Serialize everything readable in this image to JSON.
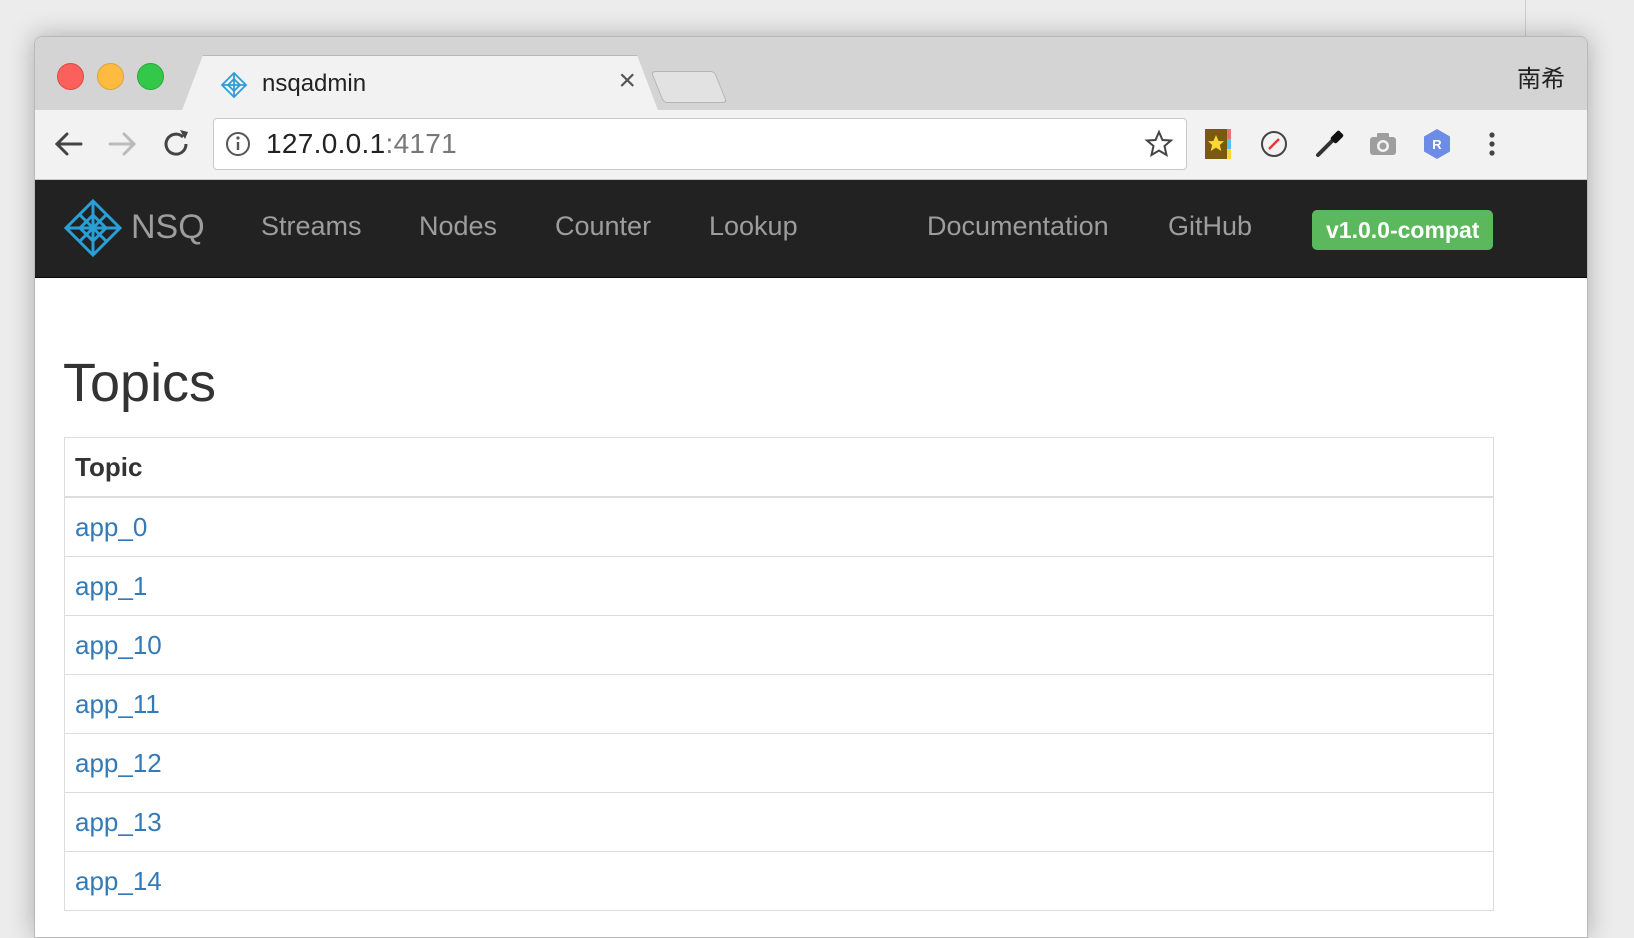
{
  "browser": {
    "tab_title": "nsqadmin",
    "tab_close": "×",
    "profile_name": "南希",
    "url_host": "127.0.0.1",
    "url_port": ":4171",
    "toolbar_icons": [
      "back-icon",
      "forward-icon",
      "reload-icon",
      "info-icon",
      "bookmark-star-icon"
    ],
    "extension_icons": [
      "starred-extension-icon",
      "compass-extension-icon",
      "eyedropper-extension-icon",
      "camera-extension-icon",
      "r-extension-icon",
      "menu-kebab-icon"
    ],
    "extension_badge_letter": "R"
  },
  "app": {
    "brand": "NSQ",
    "nav_left": [
      "Streams",
      "Nodes",
      "Counter",
      "Lookup"
    ],
    "nav_right": [
      "Documentation",
      "GitHub"
    ],
    "version": "v1.0.0-compat",
    "version_color": "#5cb85c",
    "navbar_color": "#222222"
  },
  "main": {
    "title": "Topics",
    "table": {
      "header": "Topic",
      "rows": [
        "app_0",
        "app_1",
        "app_10",
        "app_11",
        "app_12",
        "app_13",
        "app_14"
      ]
    },
    "link_color": "#337ab7"
  }
}
